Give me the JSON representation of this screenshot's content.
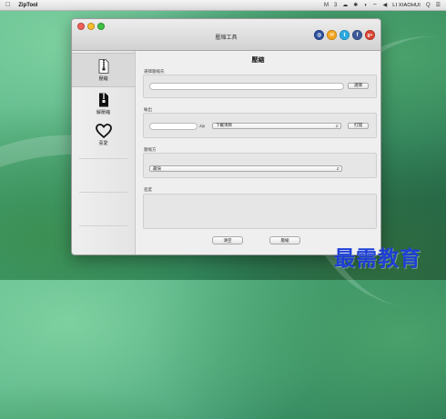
{
  "menubar": {
    "app_name": "ZipTool",
    "apple_icon": "apple-icon",
    "status_glyphs": [
      "M",
      "3",
      "☁",
      "✱",
      "◑",
      "⌔",
      "◀",
      "Q"
    ],
    "user_name": "LI XIAOHUI"
  },
  "window": {
    "title": "壓縮工具",
    "social": [
      {
        "name": "globe",
        "glyph": "◍",
        "color": "#2b4e9b"
      },
      {
        "name": "email",
        "glyph": "✉",
        "color": "#f2a21b"
      },
      {
        "name": "twitter",
        "glyph": "t",
        "color": "#2aa9e0"
      },
      {
        "name": "facebook",
        "glyph": "f",
        "color": "#3b5998"
      },
      {
        "name": "google-plus",
        "glyph": "g+",
        "color": "#d8432f"
      }
    ]
  },
  "sidebar": {
    "items": [
      {
        "label": "壓縮",
        "icon": "zipper-file-icon",
        "active": true
      },
      {
        "label": "解壓縮",
        "icon": "archive-file-icon",
        "active": false
      },
      {
        "label": "喜愛",
        "icon": "heart-icon",
        "active": false
      }
    ]
  },
  "main": {
    "title": "壓縮",
    "source": {
      "label": "選擇壓縮先",
      "input_value": "",
      "browse_label": "選擇"
    },
    "output": {
      "label": "輸出",
      "filename_value": "",
      "suffix": ".zip",
      "location_value": "下載項目",
      "open_label": "打開"
    },
    "method": {
      "label": "壓縮方",
      "select_value": "最快"
    },
    "log": {
      "label": "進度"
    },
    "buttons": {
      "clear_label": "清空",
      "compress_label": "壓縮"
    }
  },
  "watermark": "最需教育"
}
